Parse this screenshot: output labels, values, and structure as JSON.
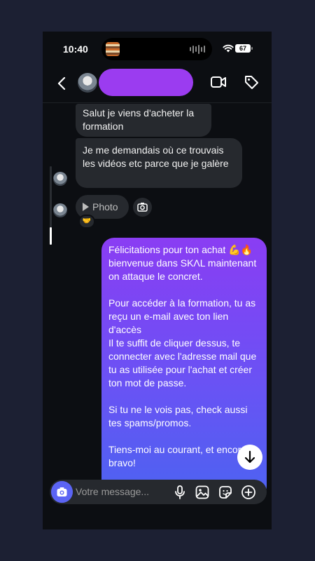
{
  "status_bar": {
    "time": "10:40",
    "battery": "67"
  },
  "conversation": {
    "incoming": [
      {
        "text": "Salut je viens d'acheter la formation"
      },
      {
        "text": "Je me demandais où ce trouvais les vidéos etc parce que je galère"
      }
    ],
    "photo_chip_label": "Photo",
    "reaction": "🤝",
    "outgoing_paragraphs": [
      "Félicitations pour ton achat 💪🔥 bienvenue dans SKΛL maintenant on attaque le concret.",
      "Pour accéder à la formation, tu as reçu un e-mail avec ton lien d'accès\nIl te suffit de cliquer dessus, te connecter avec l'adresse mail que tu as utilisée pour l'achat et créer ton mot de passe.",
      "Si tu ne le vois pas, check aussi tes spams/promos.",
      "Tiens-moi au courant, et encore bravo!"
    ]
  },
  "composer": {
    "placeholder": "Votre message..."
  },
  "icons": {
    "back": "chevron-left-icon",
    "video": "video-camera-icon",
    "tag": "tag-icon",
    "camera": "camera-icon",
    "mic": "microphone-icon",
    "gallery": "image-icon",
    "sticker": "sticker-icon",
    "add": "plus-circle-icon",
    "scroll_down": "arrow-down-icon"
  },
  "colors": {
    "accent": "#9b3cf0",
    "bubble_gradient_top": "#8a3df3",
    "bubble_gradient_bottom": "#4c63f1",
    "camera_button": "#5b64f4"
  }
}
